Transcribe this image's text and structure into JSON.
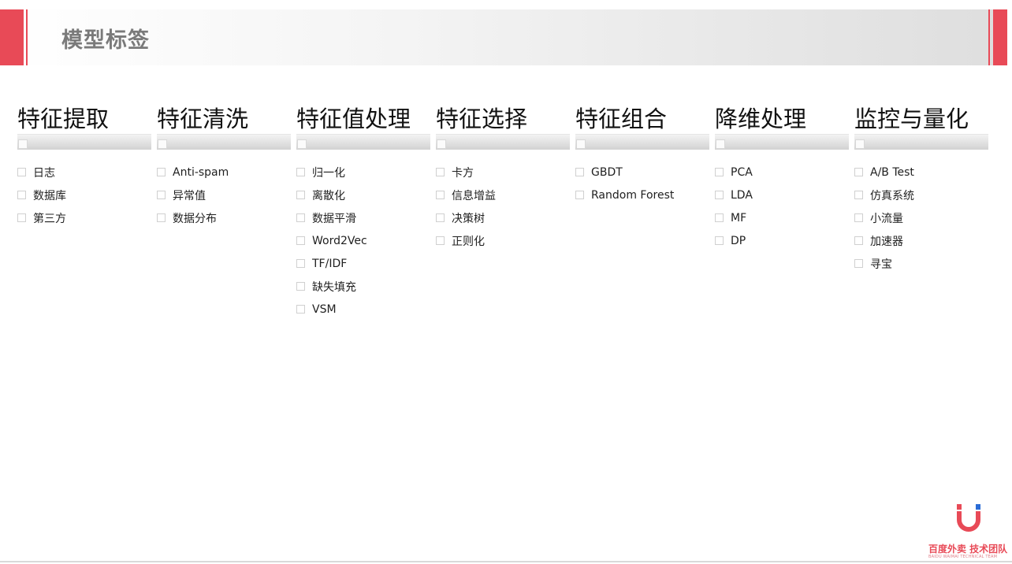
{
  "title": "模型标签",
  "columns": [
    {
      "header": "特征提取",
      "items": [
        "日志",
        "数据库",
        "第三方"
      ]
    },
    {
      "header": "特征清洗",
      "items": [
        "Anti-spam",
        "异常值",
        "数据分布"
      ]
    },
    {
      "header": "特征值处理",
      "items": [
        "归一化",
        "离散化",
        "数据平滑",
        "Word2Vec",
        "TF/IDF",
        "缺失填充",
        "VSM"
      ]
    },
    {
      "header": "特征选择",
      "items": [
        "卡方",
        "信息增益",
        "决策树",
        "正则化"
      ]
    },
    {
      "header": "特征组合",
      "items": [
        "GBDT",
        "Random Forest"
      ]
    },
    {
      "header": "降维处理",
      "items": [
        "PCA",
        "LDA",
        "MF",
        "DP"
      ]
    },
    {
      "header": "监控与量化",
      "items": [
        "A/B  Test",
        "仿真系统",
        "小流量",
        "加速器",
        "寻宝"
      ]
    }
  ],
  "logo": {
    "name": "百度外卖 技术团队",
    "sub": "BAIDU WAIMAI TECHNICAL TEAM",
    "icon": "baidu-waimai-magnet-icon"
  },
  "colors": {
    "accent": "#e84a57",
    "title": "#7a7a7a"
  }
}
